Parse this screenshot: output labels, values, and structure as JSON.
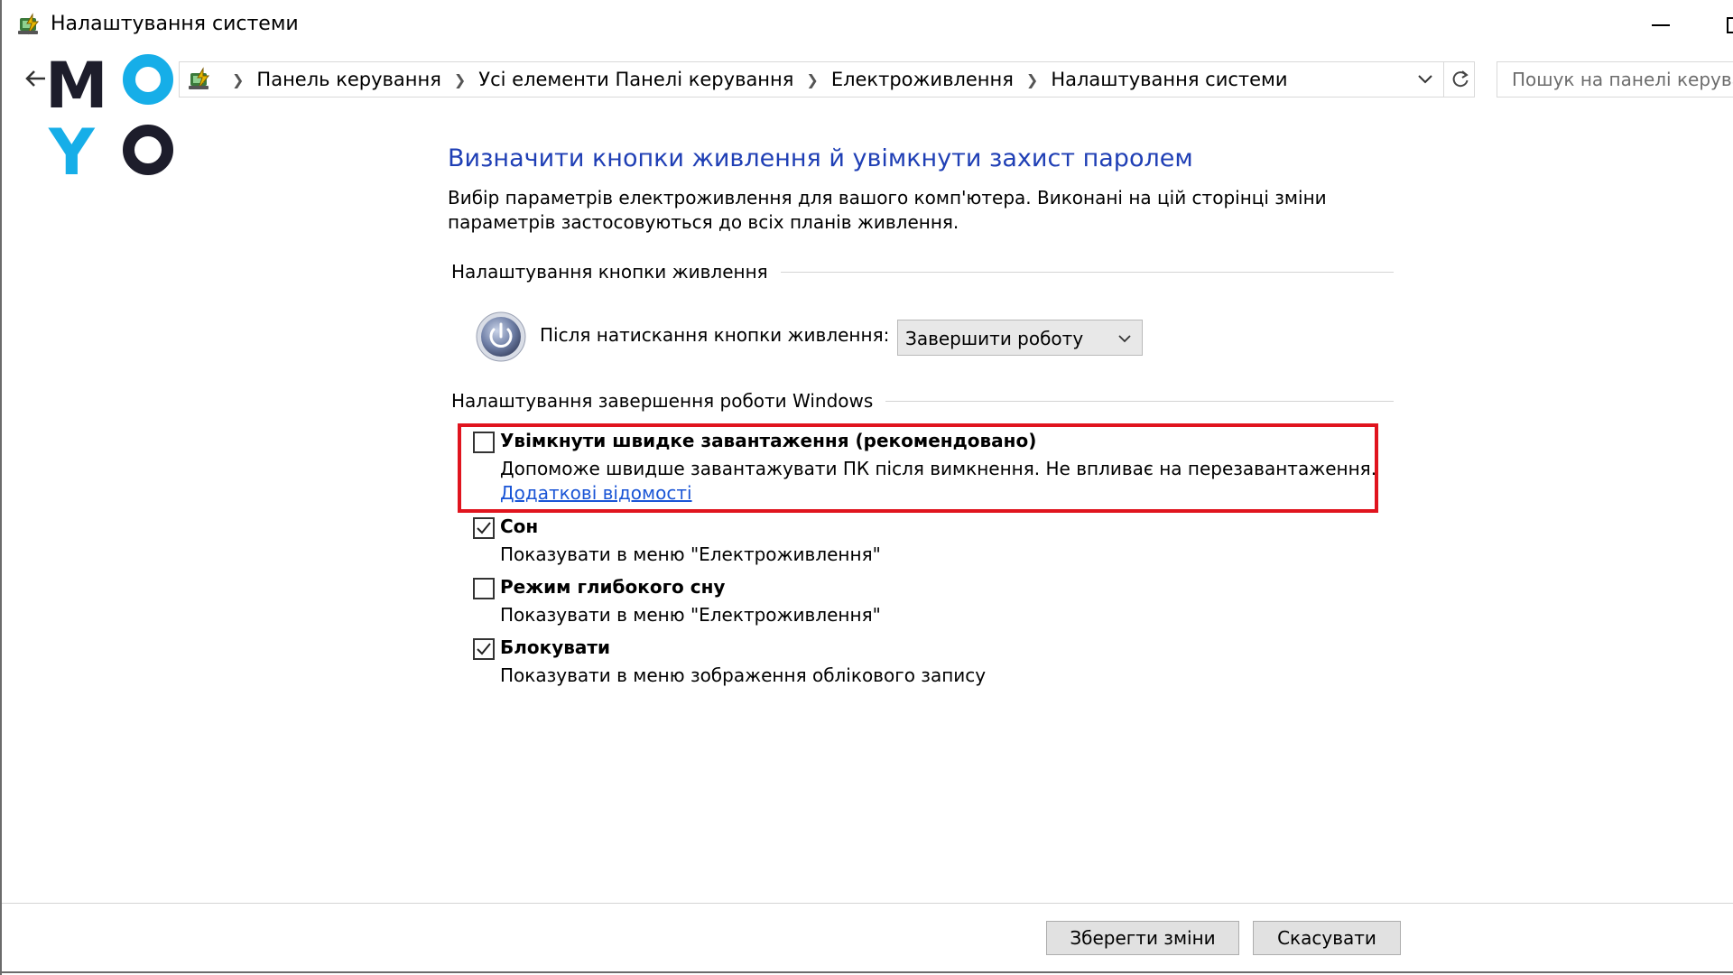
{
  "window": {
    "title": "Налаштування системи"
  },
  "logo": {
    "letters": [
      "M",
      "O",
      "Y",
      "O"
    ],
    "colors": {
      "dark": "#1d1d2b",
      "blue": "#16aee8"
    }
  },
  "address": {
    "crumbs": [
      "Панель керування",
      "Усі елементи Панелі керування",
      "Електроживлення",
      "Налаштування системи"
    ],
    "search_placeholder": "Пошук на панелі керування"
  },
  "content": {
    "heading": "Визначити кнопки живлення й увімкнути захист паролем",
    "description": "Вибір параметрів електроживлення для вашого комп'ютера. Виконані на цій сторінці зміни параметрів застосовуються до всіх планів живлення.",
    "power_section_title": "Налаштування кнопки живлення",
    "power_button_label": "Після натискання кнопки живлення:",
    "power_button_value": "Завершити роботу",
    "shutdown_section_title": "Налаштування завершення роботи Windows",
    "options": [
      {
        "title": "Увімкнути швидке завантаження (рекомендовано)",
        "description": "Допоможе швидше завантажувати ПК після вимкнення. Не впливає на перезавантаження.",
        "link": "Додаткові відомості",
        "checked": false
      },
      {
        "title": "Сон",
        "description": "Показувати в меню \"Електроживлення\"",
        "checked": true
      },
      {
        "title": "Режим глибокого сну",
        "description": "Показувати в меню \"Електроживлення\"",
        "checked": false
      },
      {
        "title": "Блокувати",
        "description": "Показувати в меню зображення облікового запису",
        "checked": true
      }
    ],
    "highlight_color": "#e0141e"
  },
  "footer": {
    "save_label": "Зберегти зміни",
    "cancel_label": "Скасувати"
  },
  "colors": {
    "heading": "#1f3fb5",
    "link": "#1a55d6"
  }
}
